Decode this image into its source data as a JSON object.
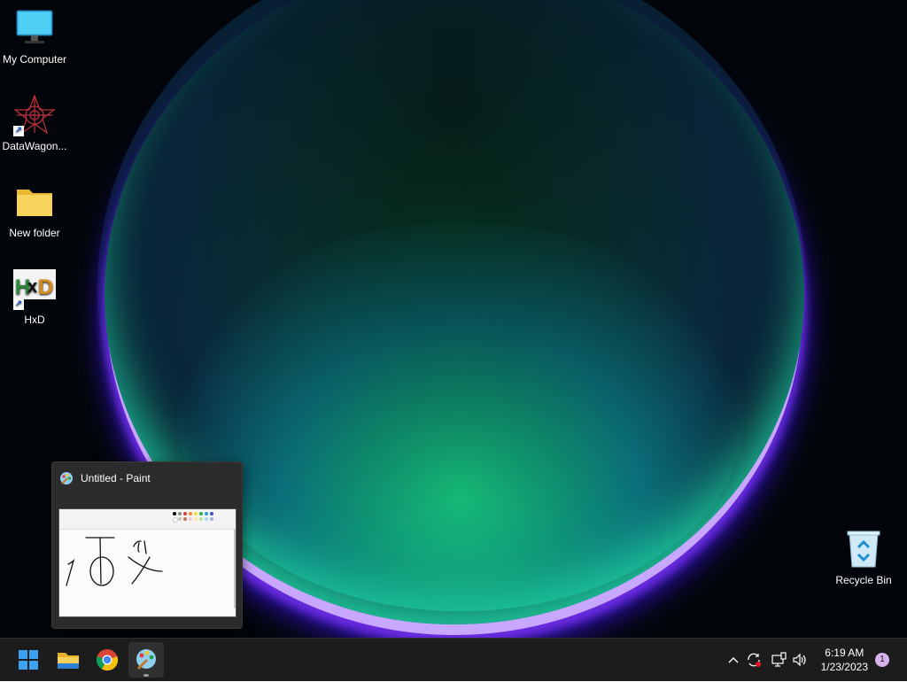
{
  "desktop_icons": [
    {
      "label": "My Computer",
      "icon": "computer-icon"
    },
    {
      "label": "DataWagon...",
      "icon": "datawagon-icon",
      "shortcut": true
    },
    {
      "label": "New folder",
      "icon": "folder-icon"
    },
    {
      "label": "HxD",
      "icon": "hxd-icon",
      "shortcut": true
    },
    {
      "label": "Recycle Bin",
      "icon": "recycle-bin-icon"
    }
  ],
  "preview": {
    "title": "Untitled - Paint",
    "canvas_text": [
      "T",
      "10",
      "61",
      "X"
    ]
  },
  "taskbar": {
    "apps": [
      {
        "name": "Start",
        "icon": "windows-start-icon"
      },
      {
        "name": "File Explorer",
        "icon": "file-explorer-icon"
      },
      {
        "name": "Google Chrome",
        "icon": "chrome-icon"
      },
      {
        "name": "Paint",
        "icon": "paint-icon",
        "active": true
      }
    ],
    "tray_icons": [
      "chevron-up-icon",
      "sync-icon",
      "network-icon",
      "volume-icon"
    ],
    "clock": {
      "time": "6:19 AM",
      "date": "1/23/2023"
    },
    "notification_count": "1"
  },
  "colors": {
    "taskbar": "#1c1c1c",
    "accent": "#0078d4",
    "notification": "#d7b4ec"
  }
}
